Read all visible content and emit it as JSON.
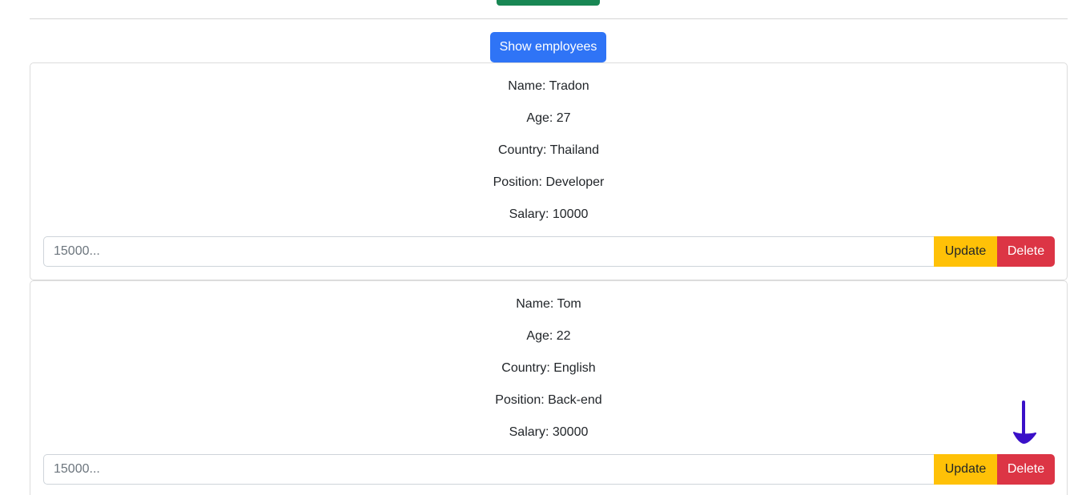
{
  "header": {
    "show_button_label": "Show employees"
  },
  "employees": [
    {
      "name": "Name: Tradon",
      "age": "Age: 27",
      "country": "Country: Thailand",
      "position": "Position: Developer",
      "salary": "Salary: 10000",
      "input_placeholder": "15000...",
      "update_label": "Update",
      "delete_label": "Delete"
    },
    {
      "name": "Name: Tom",
      "age": "Age: 22",
      "country": "Country: English",
      "position": "Position: Back-end",
      "salary": "Salary: 30000",
      "input_placeholder": "15000...",
      "update_label": "Update",
      "delete_label": "Delete"
    }
  ],
  "colors": {
    "primary": "#2f74f6",
    "warning": "#ffc107",
    "danger": "#dc3545",
    "success": "#198754",
    "annotation": "#3a10c8"
  },
  "annotation": {
    "icon": "down-arrow-icon"
  }
}
